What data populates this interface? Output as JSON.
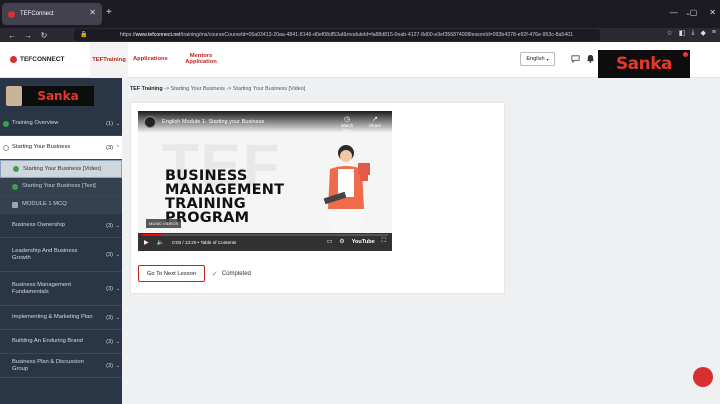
{
  "browser": {
    "tab_title": "TEFConnect",
    "url_host": "www.tefconnect.net",
    "url_rest": "/training/ms/courseCourseId=06a03413-20aa-4841-8146-d0ef08df53af&moduleId=fa88d815-0eab-4127-8d00-e9ef356874008lessonId=093b4378-e92f-476e-953c-8a5401"
  },
  "header": {
    "logo": "TEFCONNECT",
    "nav_tef": "TEFTraining",
    "nav_apps": "Applications",
    "nav_mentors": "Mentors Application",
    "language": "English",
    "brand": "Sanka"
  },
  "sidebar": {
    "brand": "Sanka",
    "items": [
      {
        "label": "Training Overview",
        "count": "(1)",
        "state": "done"
      },
      {
        "label": "Starting Your Business",
        "count": "(3)",
        "state": "active"
      },
      {
        "label": "Starting Your Business [Video]",
        "sub": true,
        "current": true
      },
      {
        "label": "Starting Your Business [Text]",
        "sub": true
      },
      {
        "label": "MODULE 1 MCQ",
        "sub": true
      },
      {
        "label": "Business Ownership",
        "count": "(3)"
      },
      {
        "label": "Leadership And Business Growth",
        "count": "(3)"
      },
      {
        "label": "Business Management Fundamentals",
        "count": "(3)"
      },
      {
        "label": "Implementing & Marketing Plan",
        "count": "(3)"
      },
      {
        "label": "Building An Enduring Brand",
        "count": "(3)"
      },
      {
        "label": "Business Plan & Discussion Group",
        "count": "(3)"
      }
    ]
  },
  "content": {
    "crumb_root": "TEF Training",
    "crumb_rest": " -> Starting Your Business -> Starting Your Business [Video]",
    "video": {
      "title": "English Module 1- Starting your Business",
      "watch_later": "Watch later",
      "share": "Share",
      "heading_line1": "BUSINESS",
      "heading_line2": "MANAGEMENT",
      "heading_line3": "TRAINING",
      "heading_line4": "PROGRAM",
      "bg_text": "TEF",
      "music": "MUSIC VIDEOS",
      "time": "0:03 / 13:20 • Table of Contents",
      "youtube": "YouTube",
      "progress": 0.08
    },
    "next_button": "Go To Next Lesson",
    "completed": "Completed"
  }
}
